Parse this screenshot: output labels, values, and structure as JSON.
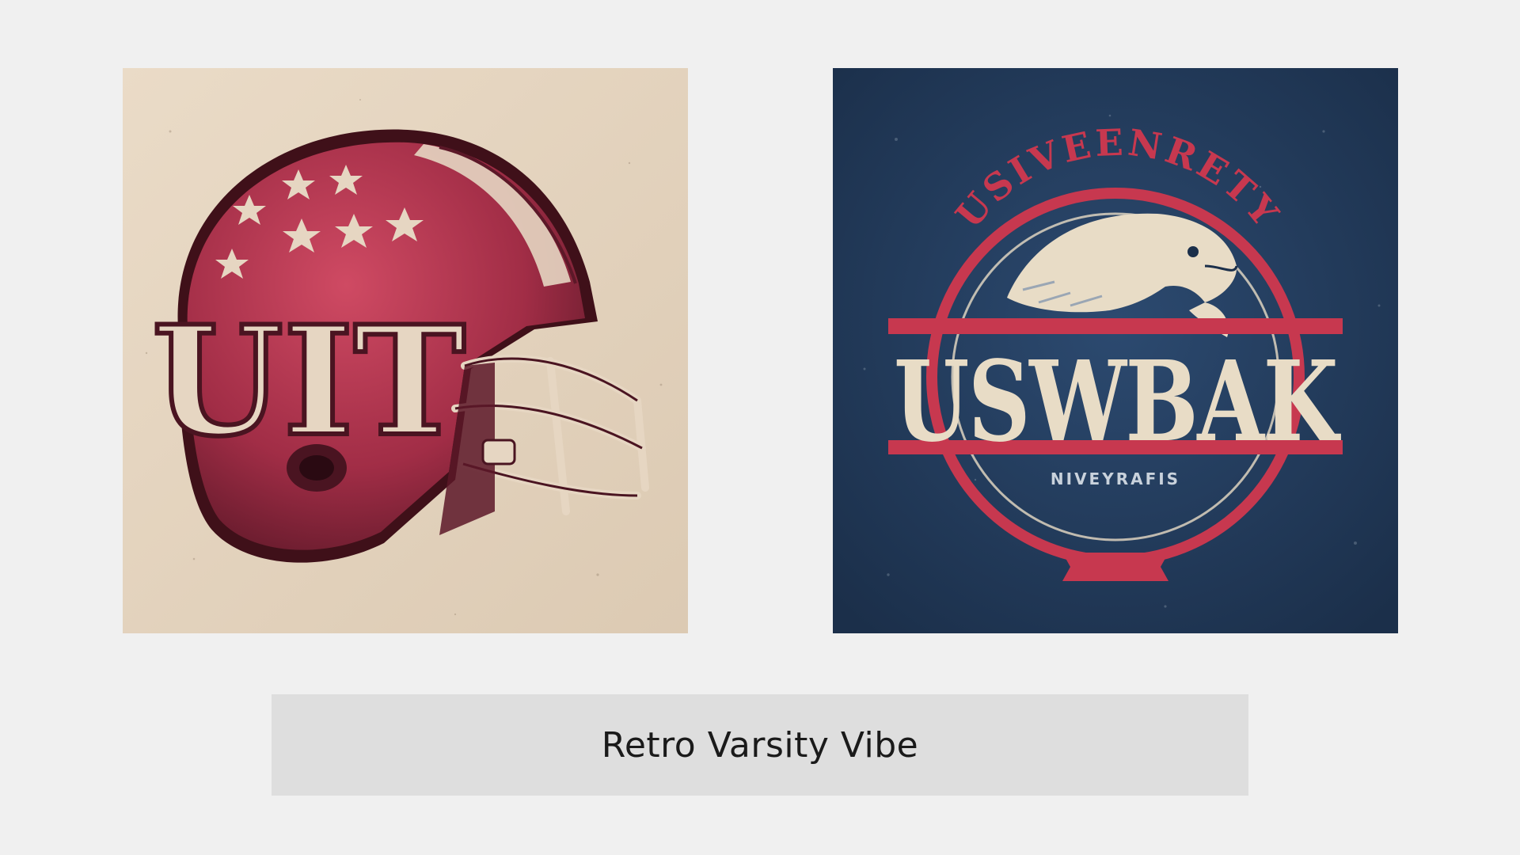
{
  "caption": {
    "text": "Retro Varsity Vibe"
  },
  "left_card": {
    "helmet_letters": "UIT",
    "background_color": "#e6d6c2",
    "helmet_color": "#b2374e",
    "helmet_dark_color": "#4a1421"
  },
  "right_card": {
    "arc_text": "USIVEENRETY",
    "main_letters": "USWBAK",
    "small_text": "NIVEYRAFIS",
    "background_color": "#233b5a",
    "accent_color": "#c7384f",
    "cream_color": "#e8dcc6"
  }
}
